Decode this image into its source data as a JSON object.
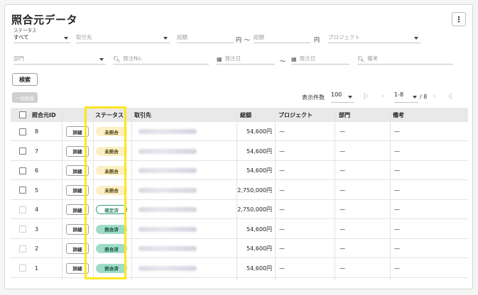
{
  "title": "照合元データ",
  "filters": {
    "status_label": "ステータス",
    "status_value": "すべて",
    "torihikisaki": "取引先",
    "sogaku": "総額",
    "yen": "円",
    "tilde": "〜",
    "project": "プロジェクト",
    "bumon": "部門",
    "hacchu_no": "発注No.",
    "hacchu_bi": "発注日",
    "biko": "備考"
  },
  "search_label": "検索",
  "bulk_delete_label": "一括削除",
  "pager": {
    "per_page_label": "表示件数",
    "per_page_value": "100",
    "range": "1-8",
    "total": "/ 8"
  },
  "columns": [
    "照合元ID",
    "ステータス",
    "取引先",
    "総額",
    "プロジェクト",
    "部門",
    "備考"
  ],
  "detail_label": "詳細",
  "rows": [
    {
      "id": "8",
      "status": "未照合",
      "kind": "unmatched",
      "amount": "54,600円",
      "project": "—",
      "bumon": "—",
      "biko": "—",
      "enabled": true
    },
    {
      "id": "7",
      "status": "未照合",
      "kind": "unmatched",
      "amount": "54,600円",
      "project": "—",
      "bumon": "—",
      "biko": "—",
      "enabled": true
    },
    {
      "id": "6",
      "status": "未照合",
      "kind": "unmatched",
      "amount": "54,600円",
      "project": "—",
      "bumon": "—",
      "biko": "—",
      "enabled": true
    },
    {
      "id": "5",
      "status": "未照合",
      "kind": "unmatched",
      "amount": "2,750,000円",
      "project": "—",
      "bumon": "—",
      "biko": "—",
      "enabled": true
    },
    {
      "id": "4",
      "status": "確定済",
      "kind": "confirmed",
      "amount": "2,750,000円",
      "project": "—",
      "bumon": "—",
      "biko": "—",
      "enabled": false
    },
    {
      "id": "3",
      "status": "照合済",
      "kind": "matched",
      "amount": "54,600円",
      "project": "—",
      "bumon": "—",
      "biko": "—",
      "enabled": false
    },
    {
      "id": "2",
      "status": "照合済",
      "kind": "matched",
      "amount": "54,600円",
      "project": "—",
      "bumon": "—",
      "biko": "—",
      "enabled": false
    },
    {
      "id": "1",
      "status": "照合済",
      "kind": "matched",
      "amount": "54,600円",
      "project": "—",
      "bumon": "—",
      "biko": "—",
      "enabled": false
    }
  ],
  "colors": {
    "highlight": "#ffe51f",
    "unmatched_bg": "#fbefc4",
    "matched_bg": "#9fdcc6",
    "confirmed_border": "#2e9d7e"
  },
  "icons": {
    "more": "more-vertical-icon",
    "search": "search-icon",
    "calendar": "calendar-icon"
  }
}
